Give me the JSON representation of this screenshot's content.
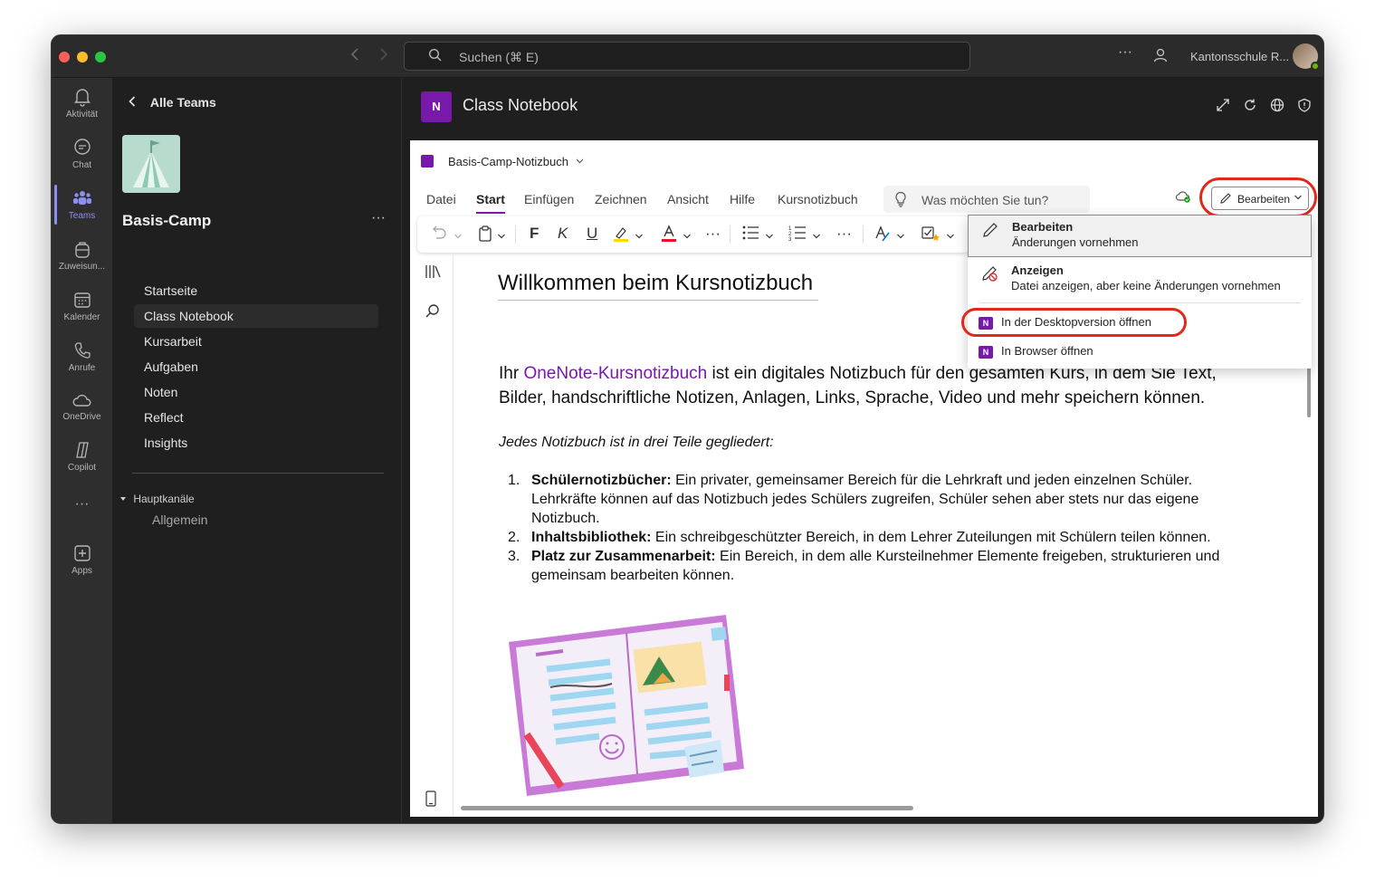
{
  "titlebar": {
    "search_placeholder": "Suchen (⌘ E)",
    "more": "···",
    "org_name": "Kantonsschule R..."
  },
  "rail": {
    "items": [
      {
        "label": "Aktivität",
        "icon": "bell-icon"
      },
      {
        "label": "Chat",
        "icon": "chat-icon"
      },
      {
        "label": "Teams",
        "icon": "teams-icon",
        "active": true
      },
      {
        "label": "Zuweisun...",
        "icon": "backpack-icon"
      },
      {
        "label": "Kalender",
        "icon": "calendar-icon"
      },
      {
        "label": "Anrufe",
        "icon": "phone-icon"
      },
      {
        "label": "OneDrive",
        "icon": "cloud-icon"
      },
      {
        "label": "Copilot",
        "icon": "copilot-icon"
      },
      {
        "label": "Apps",
        "icon": "apps-icon"
      }
    ],
    "more": "···"
  },
  "teampane": {
    "back_label": "Alle Teams",
    "team_name": "Basis-Camp",
    "more": "···",
    "channels": [
      "Startseite",
      "Class Notebook",
      "Kursarbeit",
      "Aufgaben",
      "Noten",
      "Reflect",
      "Insights"
    ],
    "active_channel": "Class Notebook",
    "section_title": "Hauptkanäle",
    "sub_channel": "Allgemein"
  },
  "app": {
    "logo_text": "N",
    "title": "Class Notebook"
  },
  "onenote": {
    "breadcrumb": "Basis-Camp-Notizbuch",
    "tabs": [
      "Datei",
      "Start",
      "Einfügen",
      "Zeichnen",
      "Ansicht",
      "Hilfe",
      "Kursnotizbuch"
    ],
    "active_tab": "Start",
    "tellme_placeholder": "Was möchten Sie tun?",
    "edit_button": "Bearbeiten",
    "ribbon": {
      "bold": "F",
      "italic": "K",
      "underline": "U",
      "more": "···"
    },
    "dropdown": {
      "edit_title": "Bearbeiten",
      "edit_desc": "Änderungen vornehmen",
      "view_title": "Anzeigen",
      "view_desc": "Datei anzeigen, aber keine Änderungen vornehmen",
      "open_desktop": "In der Desktopversion öffnen",
      "open_browser": "In Browser öffnen"
    },
    "page": {
      "title": "Willkommen beim Kursnotizbuch",
      "intro_prefix": "Ihr ",
      "intro_link": "OneNote-Kursnotizbuch",
      "intro_rest": " ist ein digitales Notizbuch für den gesamten Kurs, in dem Sie Text, Bilder, handschriftliche Notizen, Anlagen, Links, Sprache, Video und mehr speichern können.",
      "subhead": "Jedes Notizbuch ist in drei Teile gegliedert:",
      "list": [
        {
          "num": "1.",
          "term": "Schülernotizbücher:",
          "text": " Ein privater, gemeinsamer Bereich für die Lehrkraft und jeden einzelnen Schüler. Lehrkräfte können auf das Notizbuch jedes Schülers zugreifen, Schüler sehen aber stets nur das eigene Notizbuch."
        },
        {
          "num": "2.",
          "term": "Inhaltsbibliothek:",
          "text": " Ein schreibgeschützter Bereich, in dem Lehrer Zuteilungen mit Schülern teilen können."
        },
        {
          "num": "3.",
          "term": "Platz zur Zusammenarbeit:",
          "text": " Ein Bereich, in dem alle Kursteilnehmer Elemente freigeben, strukturieren und gemeinsam bearbeiten können."
        }
      ]
    }
  },
  "colors": {
    "onenote_purple": "#7719aa",
    "teams_accent": "#8b8ff0",
    "highlight_red": "#e0281c"
  }
}
